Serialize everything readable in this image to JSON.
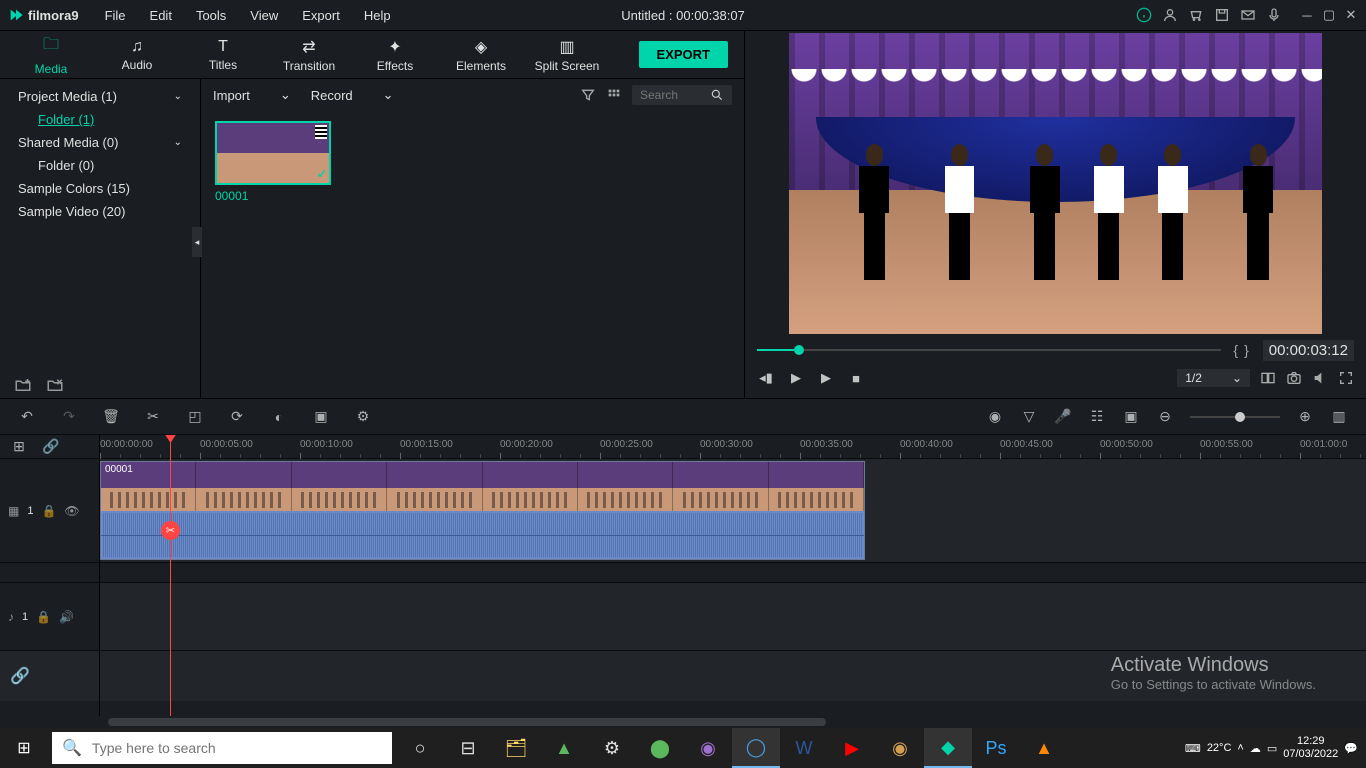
{
  "app": {
    "name": "filmora9",
    "title": "Untitled : 00:00:38:07"
  },
  "menu": [
    "File",
    "Edit",
    "Tools",
    "View",
    "Export",
    "Help"
  ],
  "titleIcons": [
    "info",
    "account",
    "cart",
    "save",
    "mail",
    "mic"
  ],
  "tabs": [
    {
      "label": "Media",
      "active": true
    },
    {
      "label": "Audio",
      "active": false
    },
    {
      "label": "Titles",
      "active": false
    },
    {
      "label": "Transition",
      "active": false
    },
    {
      "label": "Effects",
      "active": false
    },
    {
      "label": "Elements",
      "active": false
    },
    {
      "label": "Split Screen",
      "active": false
    }
  ],
  "exportLabel": "EXPORT",
  "mediaTree": {
    "items": [
      {
        "label": "Project Media (1)",
        "expandable": true
      },
      {
        "label": "Folder (1)",
        "indent": true,
        "active": true
      },
      {
        "label": "Shared Media (0)",
        "expandable": true
      },
      {
        "label": "Folder (0)",
        "indent": true
      },
      {
        "label": "Sample Colors (15)"
      },
      {
        "label": "Sample Video (20)"
      }
    ]
  },
  "mediaToolbar": {
    "import": "Import",
    "record": "Record",
    "searchPlaceholder": "Search"
  },
  "clip": {
    "name": "00001"
  },
  "preview": {
    "timecode": "00:00:03:12",
    "quality": "1/2"
  },
  "timeline": {
    "ticks": [
      "00:00:00:00",
      "00:00:05:00",
      "00:00:10:00",
      "00:00:15:00",
      "00:00:20:00",
      "00:00:25:00",
      "00:00:30:00",
      "00:00:35:00",
      "00:00:40:00",
      "00:00:45:00",
      "00:00:50:00",
      "00:00:55:00",
      "00:01:00:0"
    ],
    "clipLabel": "00001",
    "videoTrack": "1",
    "audioTrack": "1"
  },
  "watermark": {
    "title": "Activate Windows",
    "sub": "Go to Settings to activate Windows."
  },
  "taskbar": {
    "searchPlaceholder": "Type here to search",
    "temp": "22°C",
    "time": "12:29",
    "date": "07/03/2022"
  }
}
